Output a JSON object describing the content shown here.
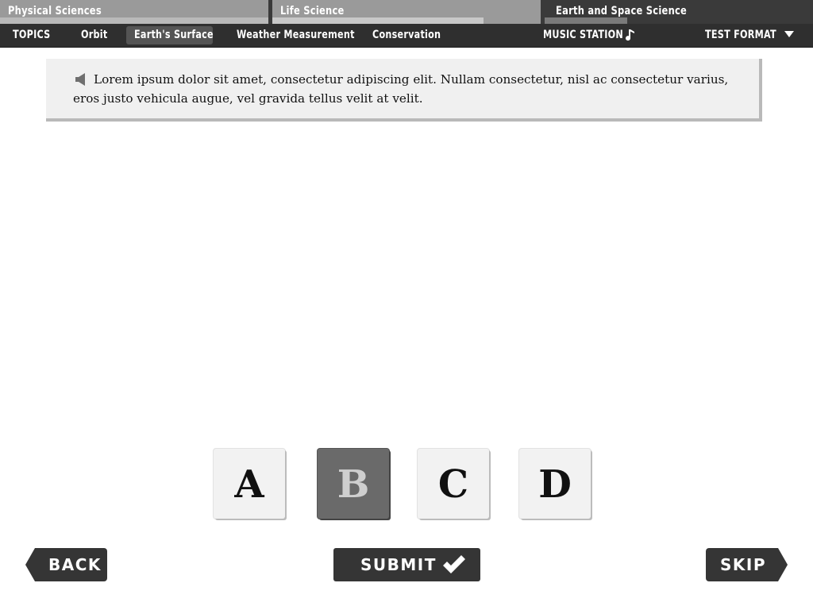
{
  "subjects": {
    "physical": "Physical Sciences",
    "life": "Life Science",
    "earth_space": "Earth and Space Science"
  },
  "topics": {
    "heading": "TOPICS",
    "items": [
      "Orbit",
      "Earth's Surface",
      "Weather Measurement",
      "Conservation"
    ],
    "active": "Earth's Surface"
  },
  "music": {
    "label": "MUSIC STATION",
    "icon": "music-note-icon"
  },
  "test_format": {
    "label": "TEST FORMAT",
    "icon": "caret-down-icon"
  },
  "prompt": {
    "icon": "speaker-icon",
    "text": "Lorem ipsum dolor sit amet, consectetur adipiscing elit. Nullam consectetur, nisl ac consectetur varius, eros justo vehicula augue, vel gravida tellus velit at velit."
  },
  "choices": {
    "a": "A",
    "b": "B",
    "c": "C",
    "d": "D",
    "selected": "B"
  },
  "buttons": {
    "back": "BACK",
    "submit": "SUBMIT",
    "skip": "SKIP",
    "submit_icon": "checkmark-icon"
  },
  "colors": {
    "nav_dark": "#2f2f2f",
    "tab_inactive": "#9a9a9a",
    "selected_choice": "#6a6a6a",
    "button": "#353535"
  }
}
